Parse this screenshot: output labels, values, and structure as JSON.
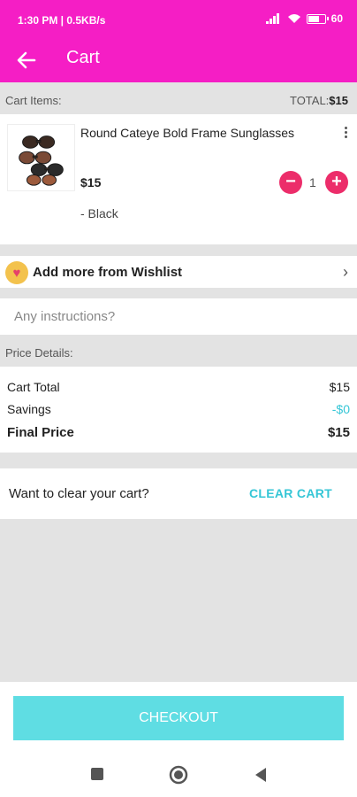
{
  "status_bar": {
    "time": "1:30 PM | 0.5KB/s",
    "battery": "60",
    "battery_level": 0.6
  },
  "header": {
    "title": "Cart"
  },
  "cart": {
    "items_label": "Cart Items:",
    "total_label": "TOTAL:",
    "total_value": "$15"
  },
  "item": {
    "name": "Round Cateye Bold Frame Sunglasses",
    "price": "$15",
    "variant": "- Black",
    "quantity": "1",
    "minus": "−",
    "plus": "+"
  },
  "wishlist": {
    "label": "Add more from Wishlist",
    "chevron": "›"
  },
  "instructions": {
    "placeholder": "Any instructions?"
  },
  "price_details": {
    "label": "Price Details:",
    "cart_total_label": "Cart Total",
    "cart_total_value": "$15",
    "savings_label": "Savings",
    "savings_value": "-$0",
    "final_label": "Final Price",
    "final_value": "$15"
  },
  "clear_cart": {
    "question": "Want to clear your cart?",
    "button": "CLEAR CART"
  },
  "checkout": {
    "label": "CHECKOUT"
  },
  "colors": {
    "brand": "#f51ec5",
    "accent": "#35c6d6",
    "checkout": "#5fdde3",
    "qty_button": "#ec2d6a"
  }
}
